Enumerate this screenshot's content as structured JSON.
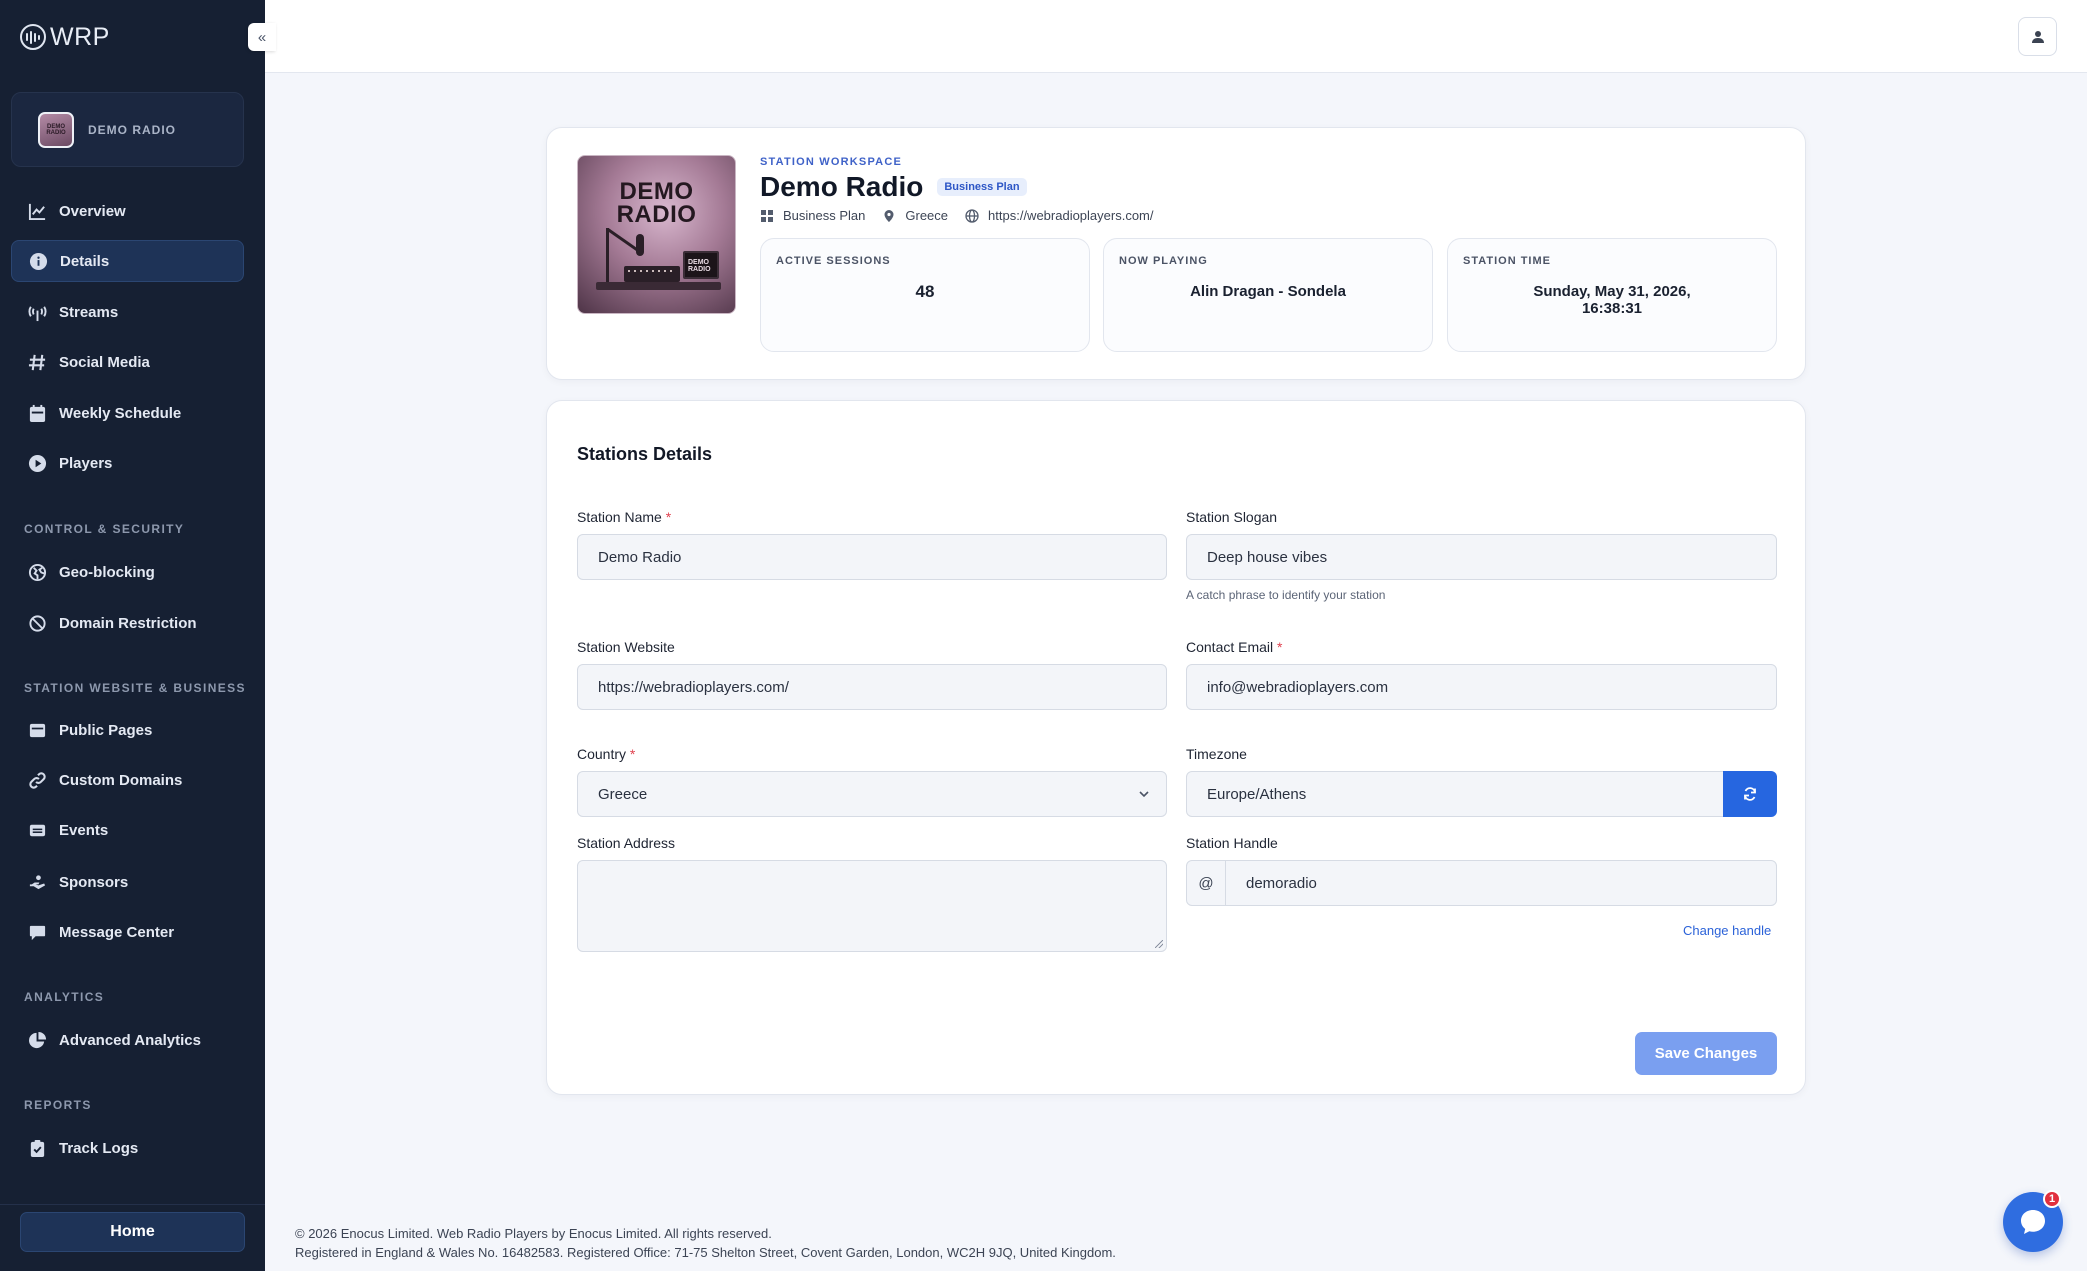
{
  "brand": {
    "name": "WRP"
  },
  "sidebar": {
    "station": {
      "name": "DEMO RADIO",
      "thumb_text": "DEMO RADIO"
    },
    "nav": [
      {
        "label": "Overview",
        "icon": "chart-line-icon"
      },
      {
        "label": "Details",
        "icon": "info-circle-icon",
        "active": true
      },
      {
        "label": "Streams",
        "icon": "broadcast-tower-icon"
      },
      {
        "label": "Social Media",
        "icon": "hashtag-icon"
      },
      {
        "label": "Weekly Schedule",
        "icon": "calendar-icon"
      },
      {
        "label": "Players",
        "icon": "play-circle-icon"
      }
    ],
    "sections": {
      "control": "CONTROL & SECURITY",
      "website": "STATION WEBSITE & BUSINESS",
      "analytics": "ANALYTICS",
      "reports": "REPORTS"
    },
    "control_items": [
      {
        "label": "Geo-blocking",
        "icon": "globe-lock-icon"
      },
      {
        "label": "Domain Restriction",
        "icon": "ban-icon"
      }
    ],
    "website_items": [
      {
        "label": "Public Pages",
        "icon": "window-icon"
      },
      {
        "label": "Custom Domains",
        "icon": "link-icon"
      },
      {
        "label": "Events",
        "icon": "ticket-icon"
      },
      {
        "label": "Sponsors",
        "icon": "handshake-icon"
      },
      {
        "label": "Message Center",
        "icon": "message-icon"
      }
    ],
    "analytics_items": [
      {
        "label": "Advanced Analytics",
        "icon": "pie-chart-icon"
      }
    ],
    "reports_items": [
      {
        "label": "Track Logs",
        "icon": "clipboard-check-icon"
      }
    ],
    "home_label": "Home"
  },
  "header": {
    "eyebrow": "STATION WORKSPACE",
    "title": "Demo Radio",
    "plan_badge": "Business Plan",
    "cover_text": "DEMO RADIO",
    "cover_screen_text": "DEMO RADIO",
    "meta": {
      "plan": "Business Plan",
      "country": "Greece",
      "website": "https://webradioplayers.com/"
    },
    "stats": [
      {
        "label": "ACTIVE SESSIONS",
        "value": "48"
      },
      {
        "label": "NOW PLAYING",
        "value": "Alin Dragan - Sondela"
      },
      {
        "label": "STATION TIME",
        "value": "Sunday, May 31, 2026, 16:38:31"
      }
    ]
  },
  "form": {
    "title": "Stations Details",
    "station_name": {
      "label": "Station Name",
      "value": "Demo Radio",
      "required": "*"
    },
    "station_slogan": {
      "label": "Station Slogan",
      "value": "Deep house vibes",
      "hint": "A catch phrase to identify your station"
    },
    "station_website": {
      "label": "Station Website",
      "value": "https://webradioplayers.com/"
    },
    "contact_email": {
      "label": "Contact Email",
      "value": "info@webradioplayers.com",
      "required": "*"
    },
    "country": {
      "label": "Country",
      "value": "Greece",
      "required": "*"
    },
    "timezone": {
      "label": "Timezone",
      "value": "Europe/Athens"
    },
    "station_address": {
      "label": "Station Address",
      "value": ""
    },
    "station_handle": {
      "label": "Station Handle",
      "prefix": "@",
      "value": "demoradio",
      "change_link": "Change handle"
    },
    "save_label": "Save Changes"
  },
  "footer": {
    "line1": "© 2026 Enocus Limited. Web Radio Players by Enocus Limited. All rights reserved.",
    "line2": "Registered in England & Wales No. 16482583. Registered Office: 71-75 Shelton Street, Covent Garden, London, WC2H 9JQ, United Kingdom."
  },
  "chat": {
    "badge": "1"
  },
  "colors": {
    "sidebar_bg": "#162033",
    "accent": "#2666e0",
    "save_button": "#7a9ff0",
    "badge": "#e1303e"
  }
}
